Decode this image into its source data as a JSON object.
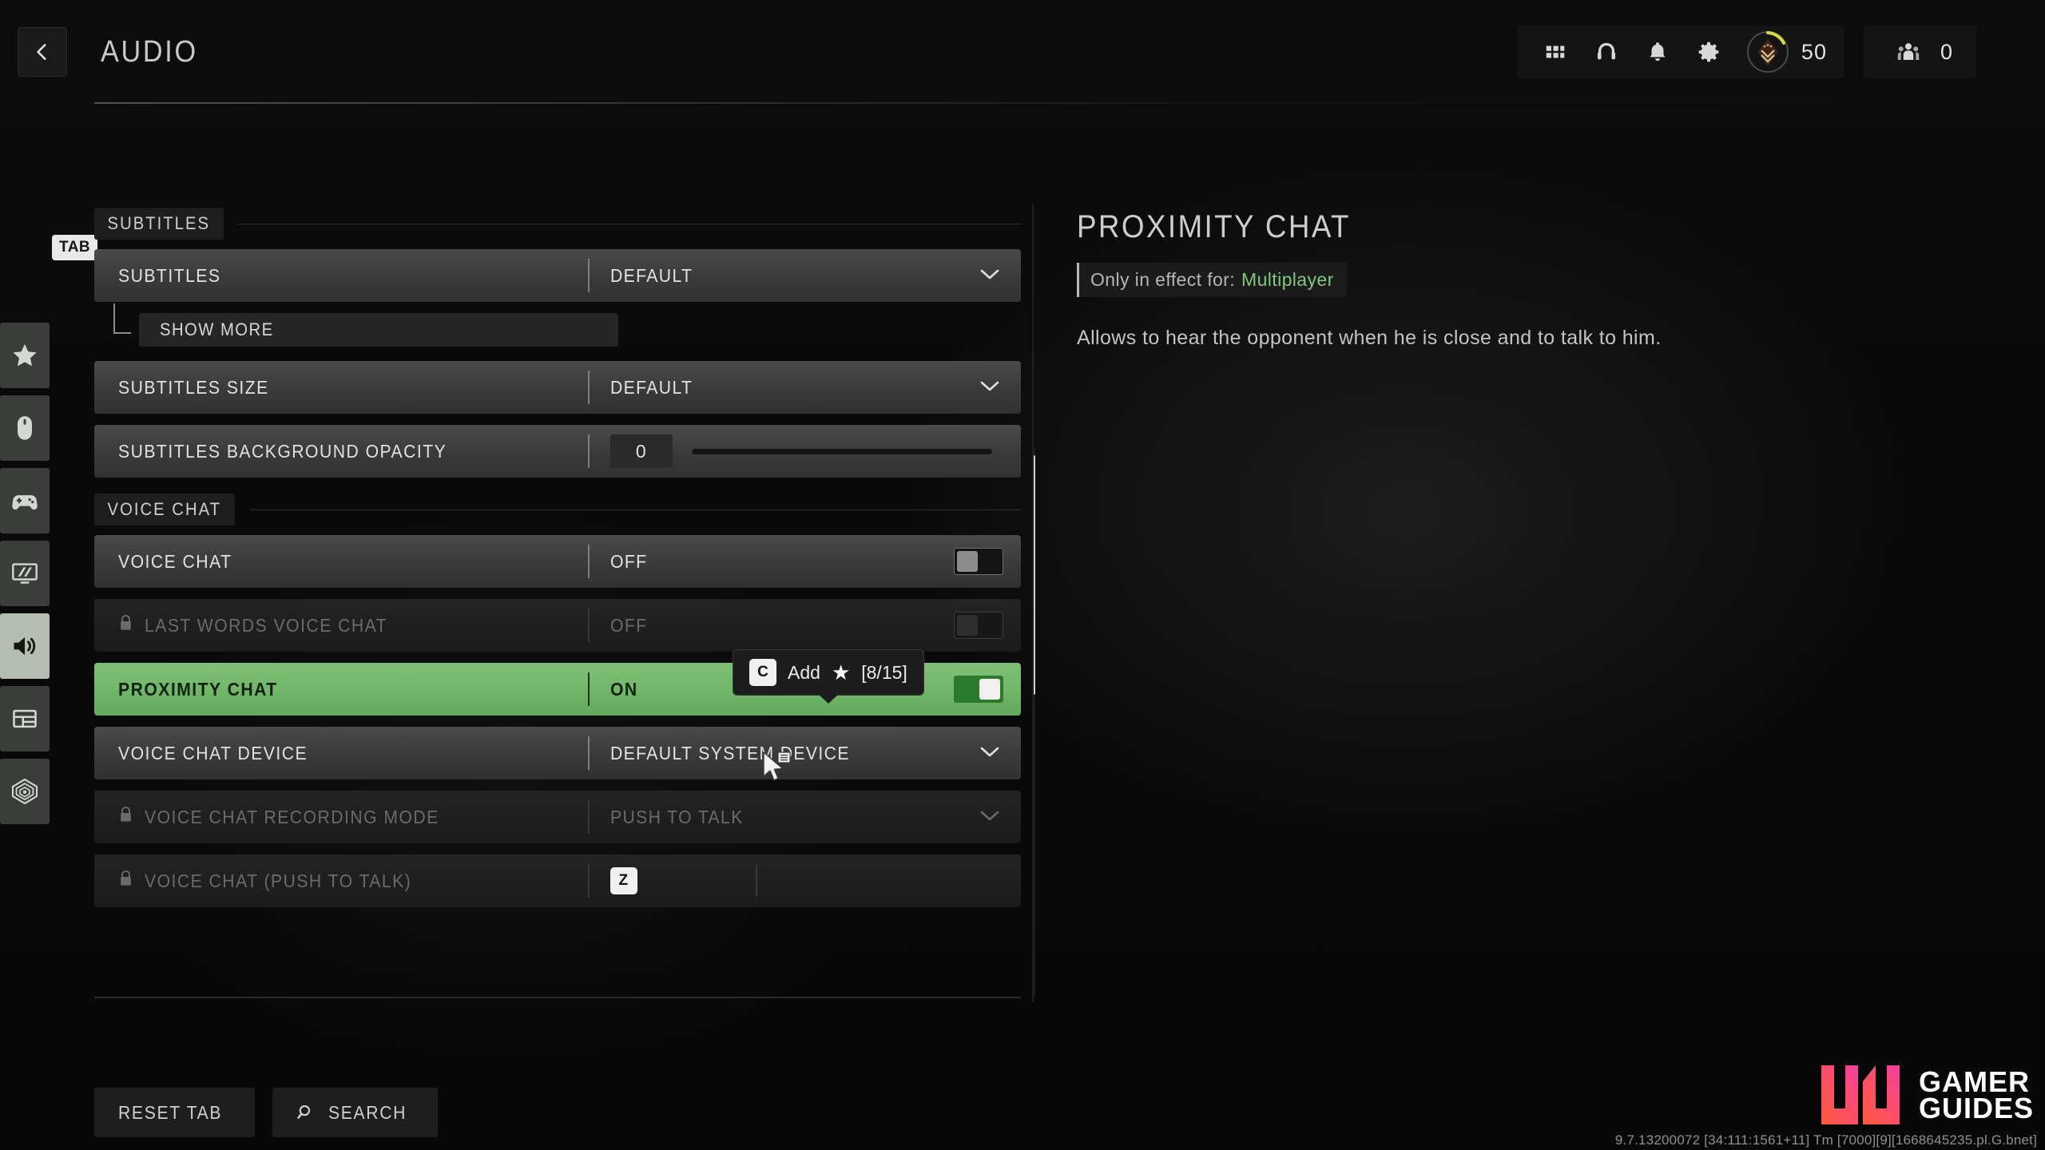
{
  "header": {
    "back_icon": "chevron-left-icon",
    "title": "AUDIO",
    "icons": [
      "grid-apps-icon",
      "headset-icon",
      "bell-icon",
      "gear-icon"
    ],
    "rank_icon": "rank-badge-icon",
    "rank_level": "50",
    "party_icon": "party-squad-icon",
    "party_count": "0"
  },
  "sidebar": {
    "tab_badge": "TAB",
    "items": [
      {
        "icon": "star-icon",
        "name": "favorites",
        "active": false
      },
      {
        "icon": "mouse-icon",
        "name": "mouse-keyboard",
        "active": false
      },
      {
        "icon": "gamepad-icon",
        "name": "controller",
        "active": false
      },
      {
        "icon": "display-icon",
        "name": "graphics",
        "active": false
      },
      {
        "icon": "speaker-icon",
        "name": "audio",
        "active": true
      },
      {
        "icon": "interface-icon",
        "name": "interface",
        "active": false
      },
      {
        "icon": "account-icon",
        "name": "account",
        "active": false
      }
    ]
  },
  "sections": [
    {
      "title": "SUBTITLES",
      "rows": [
        {
          "label": "SUBTITLES",
          "value": "DEFAULT",
          "control": "dropdown",
          "disabled": false,
          "selected": false,
          "locked": false
        },
        {
          "sub": "SHOW MORE"
        },
        {
          "label": "SUBTITLES SIZE",
          "value": "DEFAULT",
          "control": "dropdown",
          "disabled": false,
          "selected": false,
          "locked": false
        },
        {
          "label": "SUBTITLES BACKGROUND OPACITY",
          "value": "0",
          "control": "slider",
          "disabled": false,
          "selected": false,
          "locked": false
        }
      ]
    },
    {
      "title": "VOICE CHAT",
      "rows": [
        {
          "label": "VOICE CHAT",
          "value": "OFF",
          "control": "toggle-off",
          "disabled": false,
          "selected": false,
          "locked": false
        },
        {
          "label": "LAST WORDS VOICE CHAT",
          "value": "OFF",
          "control": "toggle-off",
          "disabled": true,
          "selected": false,
          "locked": true
        },
        {
          "label": "PROXIMITY CHAT",
          "value": "ON",
          "control": "toggle-on",
          "disabled": false,
          "selected": true,
          "locked": false
        },
        {
          "label": "VOICE CHAT DEVICE",
          "value": "DEFAULT SYSTEM DEVICE",
          "control": "dropdown",
          "disabled": false,
          "selected": false,
          "locked": false
        },
        {
          "label": "VOICE CHAT RECORDING MODE",
          "value": "PUSH TO TALK",
          "control": "dropdown",
          "disabled": true,
          "selected": false,
          "locked": true
        },
        {
          "label": "VOICE CHAT (PUSH TO TALK)",
          "value": "Z",
          "control": "keybind",
          "disabled": true,
          "selected": false,
          "locked": true
        }
      ]
    }
  ],
  "tooltip": {
    "key": "C",
    "action": "Add",
    "star_icon": "star-icon",
    "count": "[8/15]"
  },
  "detail": {
    "title": "PROXIMITY CHAT",
    "effect_prefix": "Only in effect for:",
    "effect_mode": "Multiplayer",
    "description": "Allows to hear the opponent when he is close and to talk to him."
  },
  "footer": {
    "reset_label": "RESET TAB",
    "search_label": "SEARCH",
    "search_icon": "search-icon"
  },
  "watermark": {
    "line1": "GAMER",
    "line2": "GUIDES"
  },
  "version": "9.7.13200072 [34:111:1561+11] Tm [7000][9][1668645235.pl.G.bnet]",
  "colors": {
    "accent_green": "#6fb567",
    "toggle_on": "#2b7a2b",
    "mode_green": "#7ec97a",
    "watermark_pink": "#ff4d6d"
  }
}
